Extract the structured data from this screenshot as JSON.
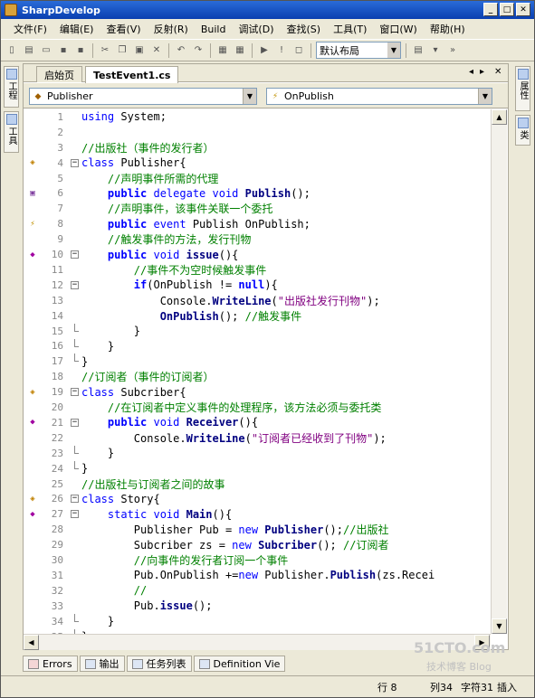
{
  "window": {
    "title": "SharpDevelop"
  },
  "menu": [
    "文件(F)",
    "编辑(E)",
    "查看(V)",
    "反射(R)",
    "Build",
    "调试(D)",
    "查找(S)",
    "工具(T)",
    "窗口(W)",
    "帮助(H)"
  ],
  "toolbar": {
    "layout_value": "默认布局"
  },
  "left_pads": [
    "工程",
    "工具"
  ],
  "right_pads": [
    "属性",
    "类"
  ],
  "tabs": [
    "启始页",
    "TestEvent1.cs"
  ],
  "class_combo": "Publisher",
  "member_combo": "OnPublish",
  "code_lines": [
    {
      "n": "1",
      "t": [
        {
          "c": "kw",
          "s": "using"
        },
        {
          "c": "",
          "s": " System;"
        }
      ]
    },
    {
      "n": "2",
      "t": []
    },
    {
      "n": "3",
      "t": [
        {
          "c": "cm",
          "s": "//出版社（事件的发行者）"
        }
      ]
    },
    {
      "n": "4",
      "t": [
        {
          "c": "kw",
          "s": "class"
        },
        {
          "c": "",
          "s": " Publisher{"
        }
      ]
    },
    {
      "n": "5",
      "t": [
        {
          "c": "cm",
          "s": "    //声明事件所需的代理"
        }
      ]
    },
    {
      "n": "6",
      "t": [
        {
          "c": "mod",
          "s": "    public"
        },
        {
          "c": "kw",
          "s": " delegate void"
        },
        {
          "c": "mt",
          "s": " Publish"
        },
        {
          "c": "",
          "s": "();"
        }
      ]
    },
    {
      "n": "7",
      "t": [
        {
          "c": "cm",
          "s": "    //声明事件，该事件关联一个委托"
        }
      ]
    },
    {
      "n": "8",
      "t": [
        {
          "c": "mod",
          "s": "    public"
        },
        {
          "c": "kw",
          "s": " event"
        },
        {
          "c": "",
          "s": " Publish OnPublish;"
        }
      ]
    },
    {
      "n": "9",
      "t": [
        {
          "c": "cm",
          "s": "    //触发事件的方法，发行刊物"
        }
      ]
    },
    {
      "n": "10",
      "t": [
        {
          "c": "mod",
          "s": "    public"
        },
        {
          "c": "kw",
          "s": " void"
        },
        {
          "c": "mt",
          "s": " issue"
        },
        {
          "c": "",
          "s": "(){"
        }
      ]
    },
    {
      "n": "11",
      "t": [
        {
          "c": "cm",
          "s": "        //事件不为空时候触发事件"
        }
      ]
    },
    {
      "n": "12",
      "t": [
        {
          "c": "mod",
          "s": "        if"
        },
        {
          "c": "",
          "s": "(OnPublish != "
        },
        {
          "c": "mod",
          "s": "null"
        },
        {
          "c": "",
          "s": "){"
        }
      ]
    },
    {
      "n": "13",
      "t": [
        {
          "c": "",
          "s": "            Console."
        },
        {
          "c": "mt",
          "s": "WriteLine"
        },
        {
          "c": "",
          "s": "("
        },
        {
          "c": "st",
          "s": "\"出版社发行刊物\""
        },
        {
          "c": "",
          "s": ");"
        }
      ]
    },
    {
      "n": "14",
      "t": [
        {
          "c": "mt",
          "s": "            OnPublish"
        },
        {
          "c": "",
          "s": "(); "
        },
        {
          "c": "cm",
          "s": "//触发事件"
        }
      ]
    },
    {
      "n": "15",
      "t": [
        {
          "c": "",
          "s": "        }"
        }
      ]
    },
    {
      "n": "16",
      "t": [
        {
          "c": "",
          "s": "    }"
        }
      ]
    },
    {
      "n": "17",
      "t": [
        {
          "c": "",
          "s": "}"
        }
      ]
    },
    {
      "n": "18",
      "t": [
        {
          "c": "cm",
          "s": "//订阅者（事件的订阅者）"
        }
      ]
    },
    {
      "n": "19",
      "t": [
        {
          "c": "kw",
          "s": "class"
        },
        {
          "c": "",
          "s": " Subcriber{"
        }
      ]
    },
    {
      "n": "20",
      "t": [
        {
          "c": "cm",
          "s": "    //在订阅者中定义事件的处理程序，该方法必须与委托类"
        }
      ]
    },
    {
      "n": "21",
      "t": [
        {
          "c": "mod",
          "s": "    public"
        },
        {
          "c": "kw",
          "s": " void"
        },
        {
          "c": "mt",
          "s": " Receiver"
        },
        {
          "c": "",
          "s": "(){"
        }
      ]
    },
    {
      "n": "22",
      "t": [
        {
          "c": "",
          "s": "        Console."
        },
        {
          "c": "mt",
          "s": "WriteLine"
        },
        {
          "c": "",
          "s": "("
        },
        {
          "c": "st",
          "s": "\"订阅者已经收到了刊物\""
        },
        {
          "c": "",
          "s": ");"
        }
      ]
    },
    {
      "n": "23",
      "t": [
        {
          "c": "",
          "s": "    }"
        }
      ]
    },
    {
      "n": "24",
      "t": [
        {
          "c": "",
          "s": "}"
        }
      ]
    },
    {
      "n": "25",
      "t": [
        {
          "c": "cm",
          "s": "//出版社与订阅者之间的故事"
        }
      ]
    },
    {
      "n": "26",
      "t": [
        {
          "c": "kw",
          "s": "class"
        },
        {
          "c": "",
          "s": " Story{"
        }
      ]
    },
    {
      "n": "27",
      "t": [
        {
          "c": "kw",
          "s": "    static void"
        },
        {
          "c": "mt",
          "s": " Main"
        },
        {
          "c": "",
          "s": "(){"
        }
      ]
    },
    {
      "n": "28",
      "t": [
        {
          "c": "",
          "s": "        Publisher Pub = "
        },
        {
          "c": "kw",
          "s": "new"
        },
        {
          "c": "mt",
          "s": " Publisher"
        },
        {
          "c": "",
          "s": "();"
        },
        {
          "c": "cm",
          "s": "//出版社"
        }
      ]
    },
    {
      "n": "29",
      "t": [
        {
          "c": "",
          "s": "        Subcriber zs = "
        },
        {
          "c": "kw",
          "s": "new"
        },
        {
          "c": "mt",
          "s": " Subcriber"
        },
        {
          "c": "",
          "s": "(); "
        },
        {
          "c": "cm",
          "s": "//订阅者"
        }
      ]
    },
    {
      "n": "30",
      "t": [
        {
          "c": "cm",
          "s": "        //向事件的发行者订阅一个事件"
        }
      ]
    },
    {
      "n": "31",
      "t": [
        {
          "c": "",
          "s": "        Pub.OnPublish +="
        },
        {
          "c": "kw",
          "s": "new"
        },
        {
          "c": "",
          "s": " Publisher."
        },
        {
          "c": "mt",
          "s": "Publish"
        },
        {
          "c": "",
          "s": "(zs.Recei"
        }
      ]
    },
    {
      "n": "32",
      "t": [
        {
          "c": "cm",
          "s": "        //"
        }
      ]
    },
    {
      "n": "33",
      "t": [
        {
          "c": "",
          "s": "        Pub."
        },
        {
          "c": "mt",
          "s": "issue"
        },
        {
          "c": "",
          "s": "();"
        }
      ]
    },
    {
      "n": "34",
      "t": [
        {
          "c": "",
          "s": "    }"
        }
      ]
    },
    {
      "n": "35",
      "t": [
        {
          "c": "",
          "s": "}"
        }
      ]
    }
  ],
  "bottom_tabs": [
    "Errors",
    "输出",
    "任务列表",
    "Definition Vie"
  ],
  "status": {
    "line": "行 8",
    "col": "列34",
    "char": "字符31",
    "mode": "插入"
  },
  "watermark": {
    "brand": "51CTO.com",
    "sub": "技术博客  Blog"
  },
  "colors": {
    "title_bar": "#0a3fb0",
    "keyword": "#0000ff",
    "comment": "#008000",
    "string": "#800080"
  }
}
